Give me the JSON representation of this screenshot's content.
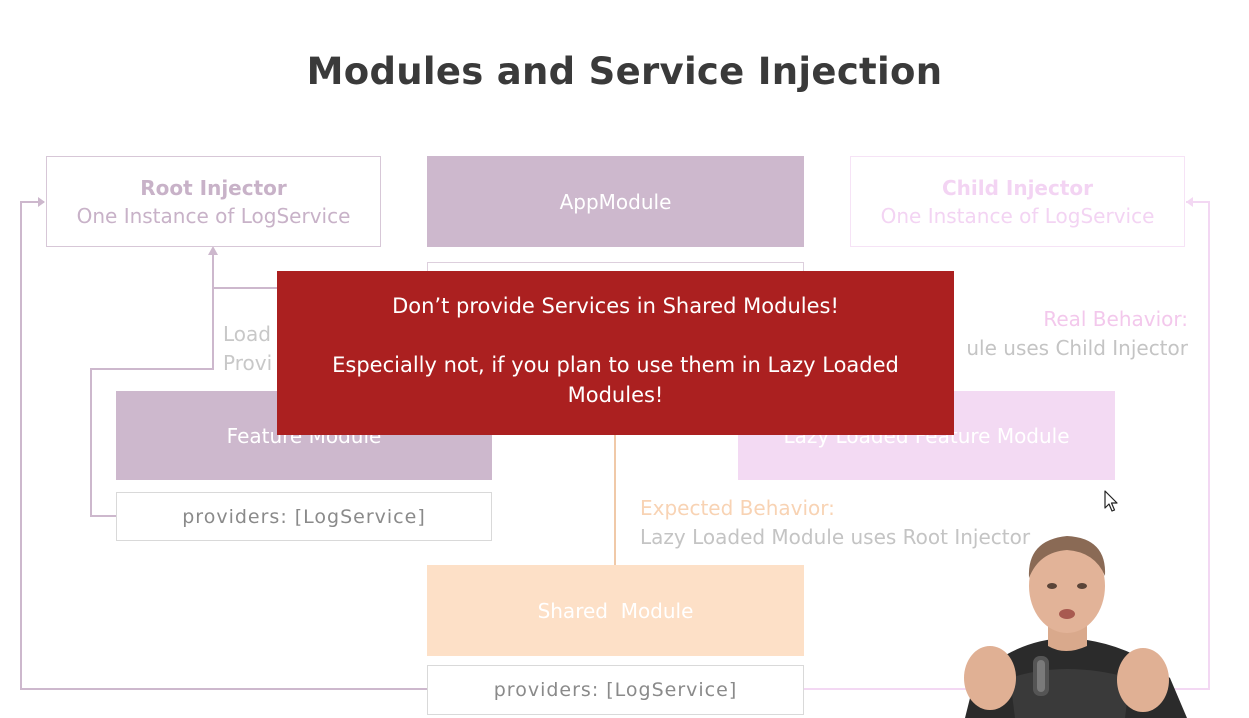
{
  "slide": {
    "title": "Modules and Service Injection"
  },
  "root_injector": {
    "title": "Root Injector",
    "subtitle": "One Instance of LogService"
  },
  "child_injector": {
    "title": "Child Injector",
    "subtitle": "One Instance of LogService"
  },
  "app_module": {
    "label": "AppModule"
  },
  "feature_module": {
    "label": "Feature Module",
    "providers": "providers: [LogService]",
    "side_note_line1": "Load",
    "side_note_line2": "Provi"
  },
  "lazy_module": {
    "label": "Lazy Loaded Feature Module"
  },
  "shared_module": {
    "label": "Shared  Module",
    "providers": "providers: [LogService]"
  },
  "real_behavior": {
    "heading": "Real Behavior:",
    "text": "ule uses Child Injector"
  },
  "expected_behavior": {
    "heading": "Expected Behavior:",
    "text": "Lazy Loaded Module uses Root Injector"
  },
  "warning_banner": {
    "line1": "Don’t provide Services in Shared Modules!",
    "line2": "Especially not, if you plan to use them in Lazy Loaded Modules!"
  },
  "colors": {
    "root_purple": "#c9b6c9",
    "child_pink": "#f3daf3",
    "shared_peach": "#fde0c7",
    "banner_red": "#ab2020"
  }
}
